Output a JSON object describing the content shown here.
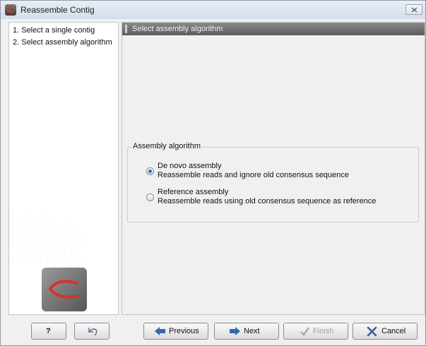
{
  "window": {
    "title": "Reassemble Contig"
  },
  "sidebar": {
    "steps": [
      {
        "label": "1. Select a single contig"
      },
      {
        "label": "2. Select assembly algorithm"
      }
    ]
  },
  "main": {
    "header": "Select assembly algorithm",
    "group": {
      "legend": "Assembly algorithm",
      "selected": "de-novo",
      "options": [
        {
          "title": "De novo assembly",
          "description": "Reassemble reads and ignore old consensus sequence",
          "checked": true
        },
        {
          "title": "Reference assembly",
          "description": "Reassemble reads using old consensus sequence as reference",
          "checked": false
        }
      ]
    }
  },
  "footer": {
    "help": "?",
    "reset_icon": "reset-arrow-icon",
    "previous": "Previous",
    "next": "Next",
    "finish": "Finish",
    "cancel": "Cancel",
    "finish_enabled": false
  },
  "colors": {
    "header_bar": "#6e6e6e",
    "radio_selected": "#2b6fc2",
    "previous_arrow": "#2e6bb0",
    "finish_check_disabled": "#9aa7b8",
    "cancel_x": "#3a5f9a"
  }
}
